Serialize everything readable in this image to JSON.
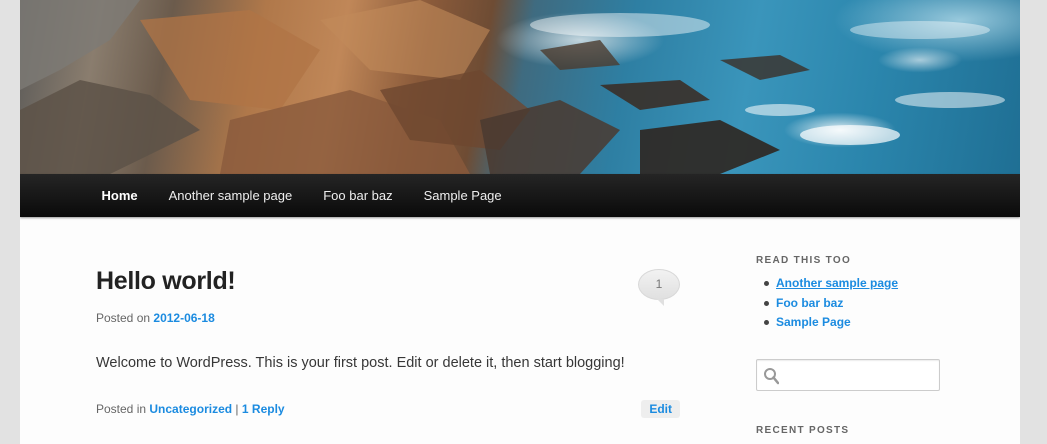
{
  "header": {
    "image_alt": "Rocky coastline with ocean waves"
  },
  "nav": {
    "items": [
      {
        "label": "Home",
        "current": true
      },
      {
        "label": "Another sample page",
        "current": false
      },
      {
        "label": "Foo bar baz",
        "current": false
      },
      {
        "label": "Sample Page",
        "current": false
      }
    ]
  },
  "post": {
    "title": "Hello world!",
    "comment_count": "1",
    "posted_on_prefix": "Posted on",
    "date": "2012-06-18",
    "content": "Welcome to WordPress. This is your first post. Edit or delete it, then start blogging!",
    "posted_in_prefix": "Posted in",
    "category": "Uncategorized",
    "separator": "|",
    "reply_label": "1 Reply",
    "edit_label": "Edit"
  },
  "sidebar": {
    "pages_widget_title": "Read this too",
    "pages": [
      {
        "label": "Another sample page"
      },
      {
        "label": "Foo bar baz"
      },
      {
        "label": "Sample Page"
      }
    ],
    "search": {
      "value": "",
      "placeholder": ""
    },
    "recent_posts_title": "Recent Posts"
  },
  "colors": {
    "link": "#1b8be0",
    "nav_bg": "#111111",
    "page_bg": "#fdfdfd",
    "body_bg": "#e2e2e2"
  }
}
